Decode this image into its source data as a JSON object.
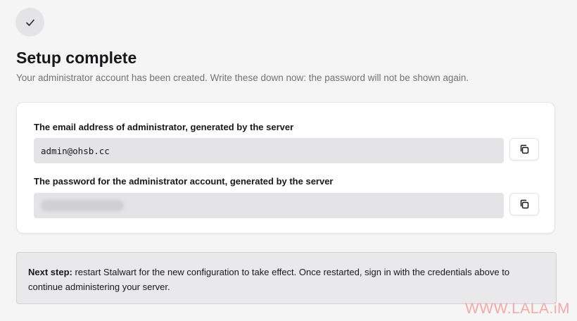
{
  "header": {
    "status_icon": "check-icon",
    "title": "Setup complete",
    "subtitle": "Your administrator account has been created. Write these down now: the password will not be shown again."
  },
  "credentials": {
    "email": {
      "label": "The email address of administrator, generated by the server",
      "value": "admin@ohsb.cc",
      "copy_icon": "copy-icon"
    },
    "password": {
      "label": "The password for the administrator account, generated by the server",
      "copy_icon": "copy-icon"
    }
  },
  "next_step": {
    "lead": "Next step:",
    "text": " restart Stalwart for the new configuration to take effect. Once restarted, sign in with the credentials above to continue administering your server."
  },
  "watermark": "WWW.LALA.iM"
}
